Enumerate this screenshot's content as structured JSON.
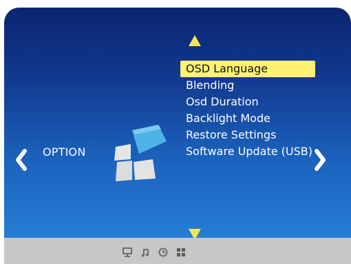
{
  "menu": {
    "category_label": "OPTION",
    "items": [
      {
        "label": "OSD Language",
        "selected": true
      },
      {
        "label": "Blending",
        "selected": false
      },
      {
        "label": "Osd Duration",
        "selected": false
      },
      {
        "label": "Backlight Mode",
        "selected": false
      },
      {
        "label": "Restore Settings",
        "selected": false
      },
      {
        "label": "Software Update (USB)",
        "selected": false
      }
    ]
  },
  "icons": {
    "nav_up": "triangle-up-icon",
    "nav_down": "triangle-down-icon",
    "prev": "chevron-left-icon",
    "next": "chevron-right-icon",
    "category": "option-tiles-icon",
    "footer_tabs": [
      "monitor-icon",
      "music-note-icon",
      "clock-icon",
      "grid-icon"
    ]
  },
  "colors": {
    "highlight": "#fff176",
    "arrow_yellow": "#f6e35a",
    "panel_top": "#0a246f",
    "panel_bottom": "#2a86dc",
    "footer": "#c7c7c7",
    "tile_light": "#e3e3e3",
    "tile_accent": "#4fb3e6"
  }
}
